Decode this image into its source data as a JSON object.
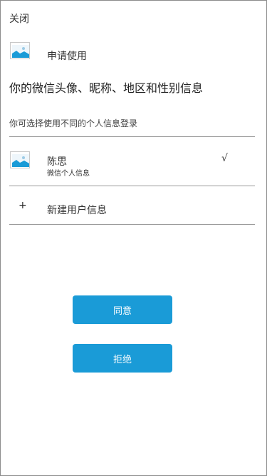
{
  "header": {
    "close_label": "关闭"
  },
  "app": {
    "icon": "image-icon",
    "name": "申请使用"
  },
  "request": {
    "headline": "你的微信头像、昵称、地区和性别信息",
    "subtitle": "你可选择使用不同的个人信息登录"
  },
  "profiles": [
    {
      "icon": "image-icon",
      "name": "陈思",
      "sub": "微信个人信息",
      "check": "√"
    }
  ],
  "new_profile": {
    "icon": "plus",
    "label": "新建用户信息",
    "symbol": "+"
  },
  "actions": {
    "agree_label": "同意",
    "reject_label": "拒绝"
  },
  "colors": {
    "button_bg": "#1a9bd7",
    "button_text": "#ffffff",
    "thumb_sky": "#eef6fb",
    "thumb_mountain": "#1a9bd7"
  }
}
